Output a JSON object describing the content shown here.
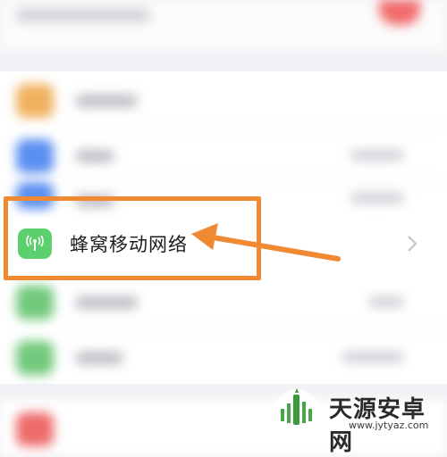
{
  "settings": {
    "cellular_label": "蜂窝移动网络",
    "icon_name": "antenna-icon",
    "chevron_icon": "chevron-right-icon"
  },
  "annotation": {
    "highlight_color": "#ef8a33"
  },
  "watermark": {
    "brand": "天源安卓网",
    "url": "www.jytyaz.com"
  },
  "colors": {
    "background": "#f2f2f6",
    "cell_icon": "#5ccf6e",
    "text": "#1c1c1e"
  }
}
